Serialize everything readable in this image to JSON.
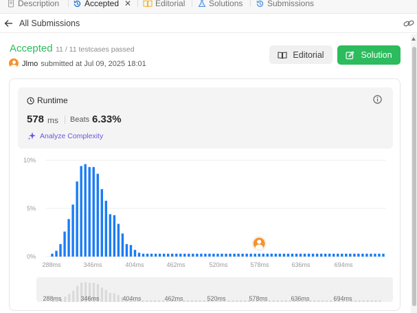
{
  "tabs": [
    {
      "label": "Description",
      "icon": "description-icon",
      "active": false
    },
    {
      "label": "Accepted",
      "icon": "history-icon",
      "active": true
    },
    {
      "label": "Editorial",
      "icon": "book-icon",
      "active": false
    },
    {
      "label": "Solutions",
      "icon": "flask-icon",
      "active": false
    },
    {
      "label": "Submissions",
      "icon": "history-icon",
      "active": false
    }
  ],
  "nav": {
    "back_label": "All Submissions"
  },
  "submission": {
    "status": "Accepted",
    "testcases": "11 / 11 testcases passed",
    "username": "Jlmo",
    "submitted_text": "submitted at Jul 09, 2025 18:01"
  },
  "actions": {
    "editorial_label": "Editorial",
    "solution_label": "Solution"
  },
  "runtime": {
    "label": "Runtime",
    "value": "578",
    "unit": "ms",
    "beats_label": "Beats",
    "beats_value": "6.33%",
    "analyze_label": "Analyze Complexity"
  },
  "colors": {
    "accent": "#2cbb5d",
    "bar": "#1a7cf5",
    "purple": "#6d55d8",
    "avatar": "#f6922e"
  },
  "chart_data": {
    "type": "bar",
    "title": "",
    "xlabel": "",
    "ylabel": "",
    "ylim": [
      0,
      10
    ],
    "y_ticks": [
      "10%",
      "5%",
      "0%"
    ],
    "x_tick_labels": [
      "288ms",
      "346ms",
      "404ms",
      "462ms",
      "520ms",
      "578ms",
      "636ms",
      "694ms"
    ],
    "highlight_label": "578ms",
    "values": [
      0.3,
      0.6,
      1.3,
      2.6,
      3.9,
      5.4,
      7.8,
      9.4,
      9.6,
      9.3,
      9.3,
      8.6,
      7.0,
      5.8,
      4.4,
      4.3,
      3.4,
      2.4,
      1.3,
      1.2,
      0.7,
      0.4,
      0.3,
      0.3,
      0.3,
      0.3,
      0.3,
      0.3,
      0.3,
      0.3,
      0.3,
      0.3,
      0.3,
      0.3,
      0.3,
      0.3,
      0.3,
      0.3,
      0.3,
      0.3,
      0.3,
      0.3,
      0.3,
      0.3,
      0.3,
      0.3,
      0.3,
      0.3,
      0.3,
      0.3,
      0.3,
      0.3,
      0.3,
      0.3,
      0.3,
      0.3,
      0.3,
      0.3,
      0.3,
      0.3,
      0.3,
      0.3,
      0.3,
      0.3,
      0.3,
      0.3,
      0.3,
      0.3,
      0.3,
      0.3,
      0.3,
      0.3,
      0.3,
      0.3,
      0.3,
      0.3,
      0.3,
      0.3,
      0.3,
      0.3,
      0.3
    ],
    "highlight_index": 50
  }
}
